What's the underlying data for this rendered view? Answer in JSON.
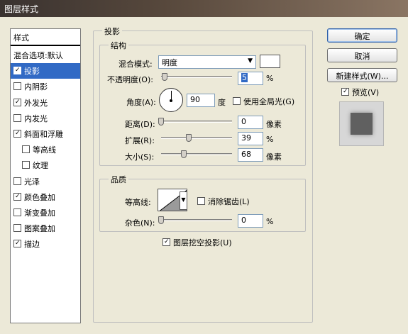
{
  "window": {
    "title": "图层样式"
  },
  "styles_list": {
    "header": "样式",
    "items": [
      {
        "label": "混合选项:默认",
        "checkbox": false,
        "checked": false,
        "indent": false,
        "selected": false
      },
      {
        "label": "投影",
        "checkbox": true,
        "checked": true,
        "indent": false,
        "selected": true
      },
      {
        "label": "内阴影",
        "checkbox": true,
        "checked": false,
        "indent": false,
        "selected": false
      },
      {
        "label": "外发光",
        "checkbox": true,
        "checked": true,
        "indent": false,
        "selected": false
      },
      {
        "label": "内发光",
        "checkbox": true,
        "checked": false,
        "indent": false,
        "selected": false
      },
      {
        "label": "斜面和浮雕",
        "checkbox": true,
        "checked": true,
        "indent": false,
        "selected": false
      },
      {
        "label": "等高线",
        "checkbox": true,
        "checked": false,
        "indent": true,
        "selected": false
      },
      {
        "label": "纹理",
        "checkbox": true,
        "checked": false,
        "indent": true,
        "selected": false
      },
      {
        "label": "光泽",
        "checkbox": true,
        "checked": false,
        "indent": false,
        "selected": false
      },
      {
        "label": "颜色叠加",
        "checkbox": true,
        "checked": true,
        "indent": false,
        "selected": false
      },
      {
        "label": "渐变叠加",
        "checkbox": true,
        "checked": false,
        "indent": false,
        "selected": false
      },
      {
        "label": "图案叠加",
        "checkbox": true,
        "checked": false,
        "indent": false,
        "selected": false
      },
      {
        "label": "描边",
        "checkbox": true,
        "checked": true,
        "indent": false,
        "selected": false
      }
    ]
  },
  "drop_shadow": {
    "section_title": "投影",
    "structure": {
      "title": "结构",
      "blend_mode_label": "混合模式:",
      "blend_mode_value": "明度",
      "blend_color": "#ffffff",
      "opacity_label": "不透明度(O):",
      "opacity_value": "5",
      "opacity_unit": "%",
      "angle_label": "角度(A):",
      "angle_value": "90",
      "angle_unit": "度",
      "global_light_label": "使用全局光(G)",
      "global_light_checked": false,
      "distance_label": "距离(D):",
      "distance_value": "0",
      "distance_unit": "像素",
      "spread_label": "扩展(R):",
      "spread_value": "39",
      "spread_unit": "%",
      "size_label": "大小(S):",
      "size_value": "68",
      "size_unit": "像素"
    },
    "quality": {
      "title": "品质",
      "contour_label": "等高线:",
      "anti_alias_label": "消除锯齿(L)",
      "anti_alias_checked": false,
      "noise_label": "杂色(N):",
      "noise_value": "0",
      "noise_unit": "%"
    },
    "knockout_label": "图层挖空投影(U)",
    "knockout_checked": true
  },
  "buttons": {
    "ok": "确定",
    "cancel": "取消",
    "new_style": "新建样式(W)...",
    "preview_label": "预览(V)",
    "preview_checked": true
  },
  "colors": {
    "selection": "#316ac5",
    "dialog_bg": "#ece9d8"
  }
}
